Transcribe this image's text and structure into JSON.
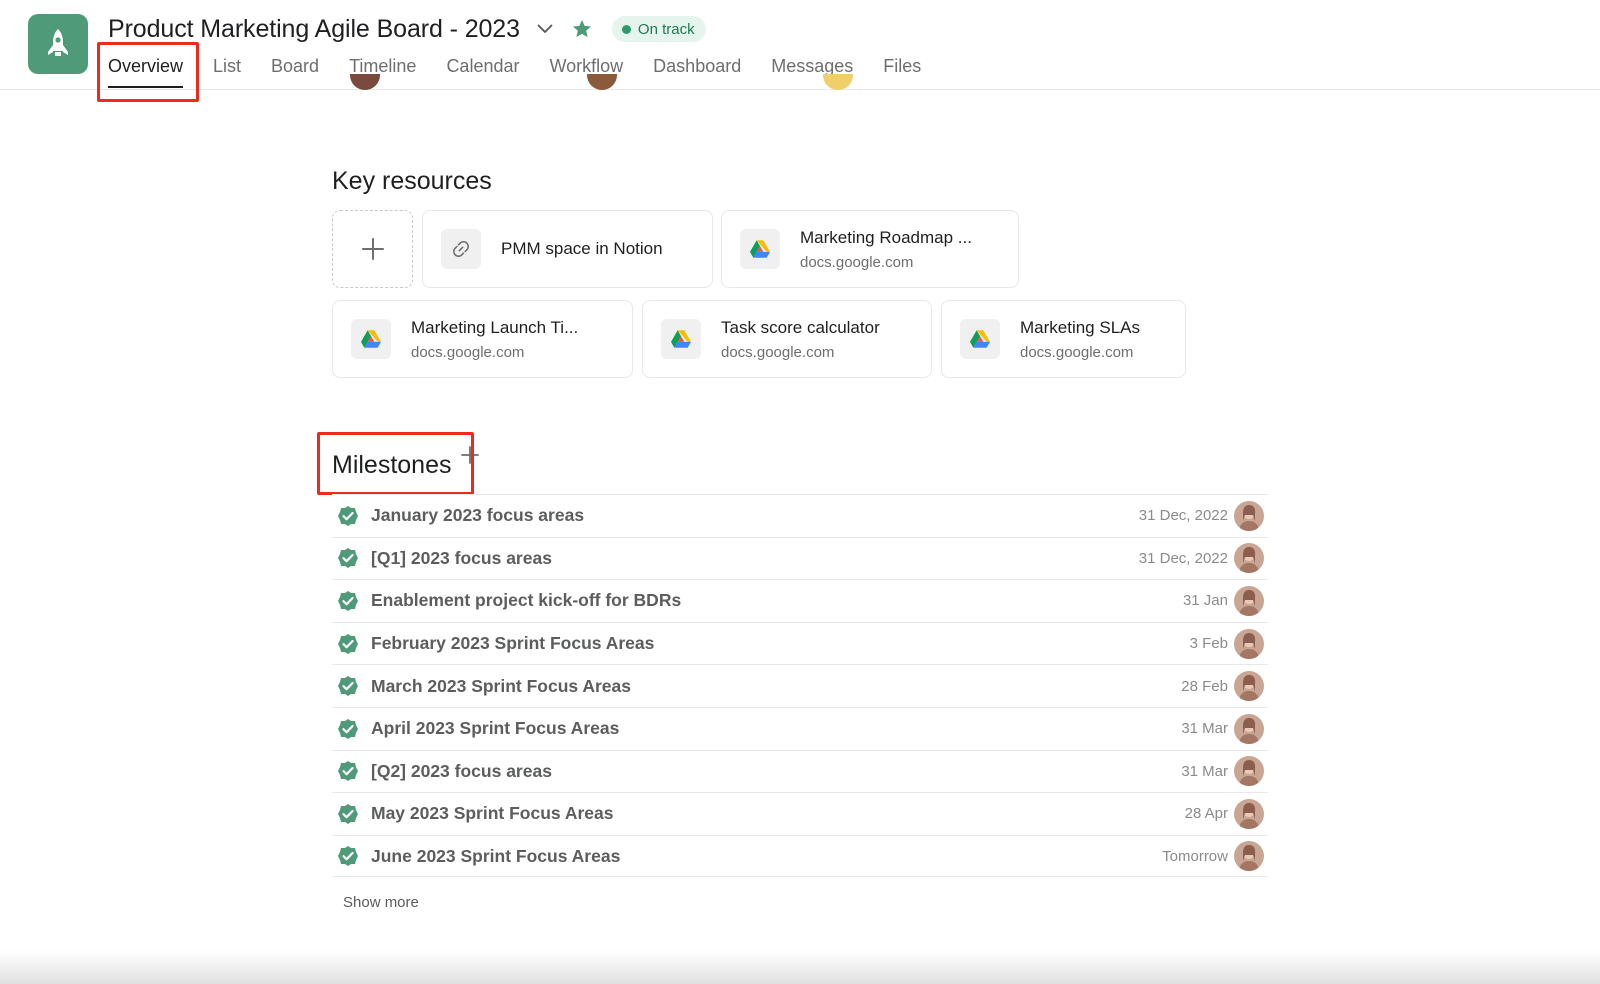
{
  "header": {
    "project_title": "Product Marketing Agile Board - 2023",
    "status": "On track",
    "colors": {
      "brand": "#4f9a79",
      "status": "#2e9a6b",
      "annotation": "#ee2a1b"
    }
  },
  "tabs": [
    {
      "label": "Overview",
      "active": true
    },
    {
      "label": "List"
    },
    {
      "label": "Board"
    },
    {
      "label": "Timeline"
    },
    {
      "label": "Calendar"
    },
    {
      "label": "Workflow"
    },
    {
      "label": "Dashboard"
    },
    {
      "label": "Messages"
    },
    {
      "label": "Files"
    }
  ],
  "key_resources": {
    "title": "Key resources",
    "items": [
      {
        "name": "PMM space in Notion",
        "domain": "",
        "icon": "link-icon"
      },
      {
        "name": "Marketing Roadmap ...",
        "domain": "docs.google.com",
        "icon": "google-drive-icon"
      },
      {
        "name": "Marketing Launch Ti...",
        "domain": "docs.google.com",
        "icon": "google-drive-icon"
      },
      {
        "name": "Task score calculator",
        "domain": "docs.google.com",
        "icon": "google-drive-icon"
      },
      {
        "name": "Marketing SLAs",
        "domain": "docs.google.com",
        "icon": "google-drive-icon"
      }
    ]
  },
  "milestones": {
    "title": "Milestones",
    "items": [
      {
        "name": "January 2023 focus areas",
        "date": "31 Dec, 2022"
      },
      {
        "name": "[Q1] 2023 focus areas",
        "date": "31 Dec, 2022"
      },
      {
        "name": "Enablement project kick-off for BDRs",
        "date": "31 Jan"
      },
      {
        "name": "February 2023 Sprint Focus Areas",
        "date": "3 Feb"
      },
      {
        "name": "March 2023 Sprint Focus Areas",
        "date": "28 Feb"
      },
      {
        "name": "April 2023 Sprint Focus Areas",
        "date": "31 Mar"
      },
      {
        "name": "[Q2] 2023 focus areas",
        "date": "31 Mar"
      },
      {
        "name": "May 2023 Sprint Focus Areas",
        "date": "28 Apr"
      },
      {
        "name": "June 2023 Sprint Focus Areas",
        "date": "Tomorrow"
      }
    ],
    "show_more": "Show more"
  }
}
